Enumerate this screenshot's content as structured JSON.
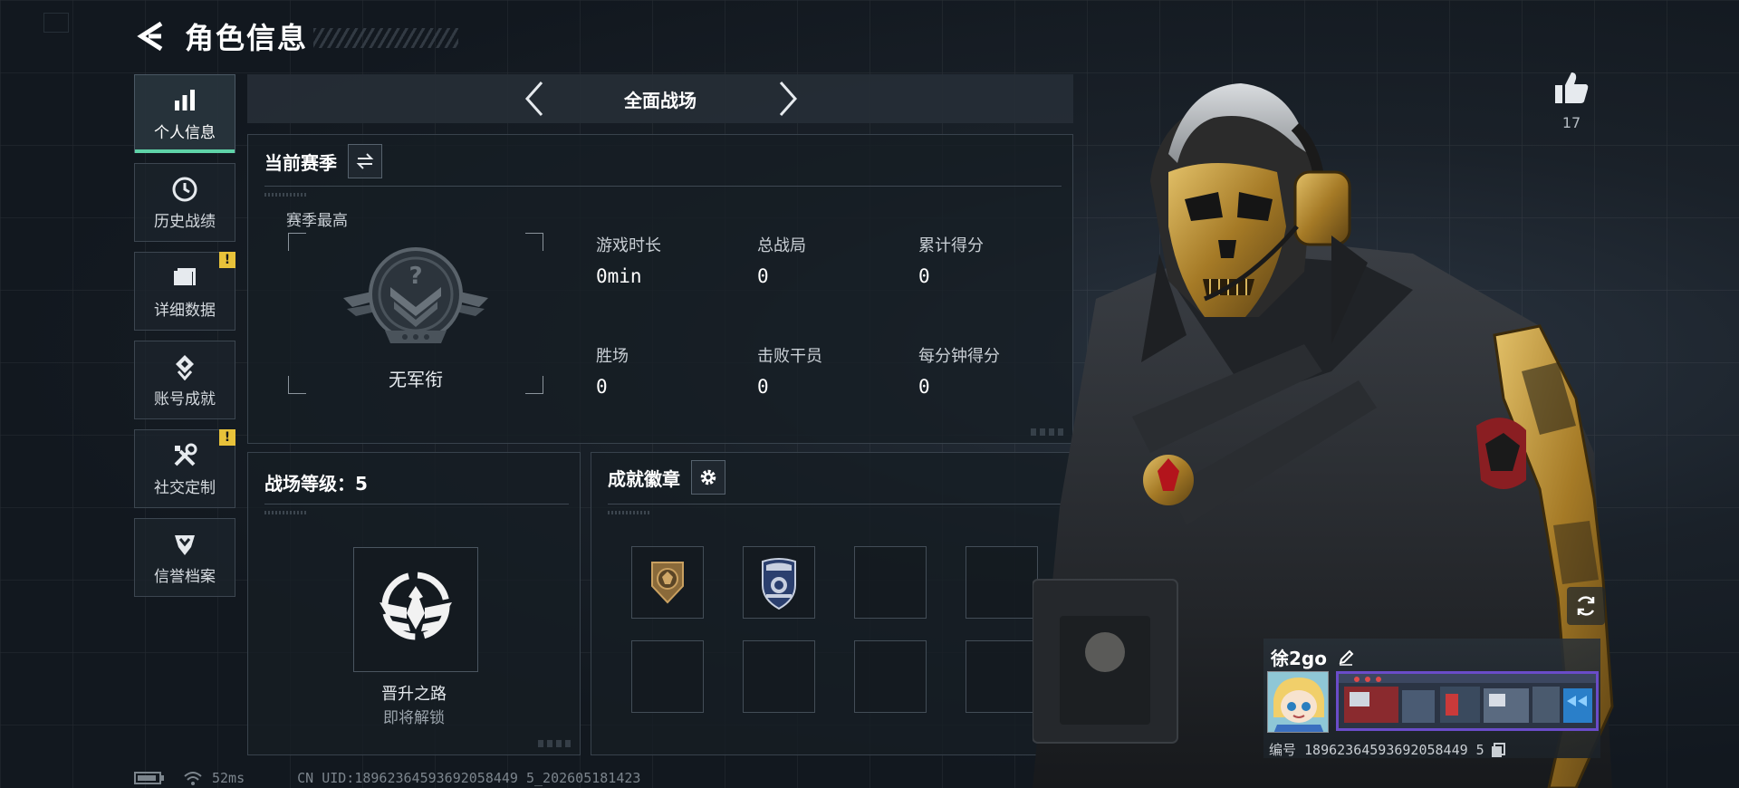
{
  "header": {
    "title": "角色信息"
  },
  "sidebar": {
    "items": [
      {
        "label": "个人信息",
        "icon": "bar-chart-icon",
        "active": true,
        "alert": false
      },
      {
        "label": "历史战绩",
        "icon": "clock-icon",
        "active": false,
        "alert": false
      },
      {
        "label": "详细数据",
        "icon": "folder-icon",
        "active": false,
        "alert": true
      },
      {
        "label": "账号成就",
        "icon": "medal-icon",
        "active": false,
        "alert": false
      },
      {
        "label": "社交定制",
        "icon": "tools-icon",
        "active": false,
        "alert": true
      },
      {
        "label": "信誉档案",
        "icon": "shield-icon",
        "active": false,
        "alert": false
      }
    ],
    "alert_mark": "!"
  },
  "mode": {
    "title": "全面战场"
  },
  "season": {
    "title": "当前赛季",
    "best_label": "赛季最高",
    "rank_name": "无军衔",
    "stats": [
      {
        "label": "游戏时长",
        "value": "0min"
      },
      {
        "label": "总战局",
        "value": "0"
      },
      {
        "label": "累计得分",
        "value": "0"
      },
      {
        "label": "胜场",
        "value": "0"
      },
      {
        "label": "击败干员",
        "value": "0"
      },
      {
        "label": "每分钟得分",
        "value": "0"
      }
    ]
  },
  "battlefield": {
    "title": "战场等级：5",
    "promo_name": "晋升之路",
    "promo_status": "即将解锁"
  },
  "badges": {
    "title": "成就徽章",
    "slots": [
      "bronze-lion-badge",
      "blue-police-badge",
      "empty",
      "empty",
      "empty",
      "empty",
      "empty",
      "empty"
    ]
  },
  "likes": {
    "count": "17"
  },
  "player": {
    "name": "徐2go",
    "id_text": "编号 18962364593692058449 5"
  },
  "status_bar": {
    "ping": "52ms",
    "uid": "CN UID:18962364593692058449 5_202605181423"
  },
  "colors": {
    "accent": "#5fd3a8",
    "alert": "#e8c23a",
    "gold": "#b8902e",
    "banner_border": "#6a4cc9"
  }
}
